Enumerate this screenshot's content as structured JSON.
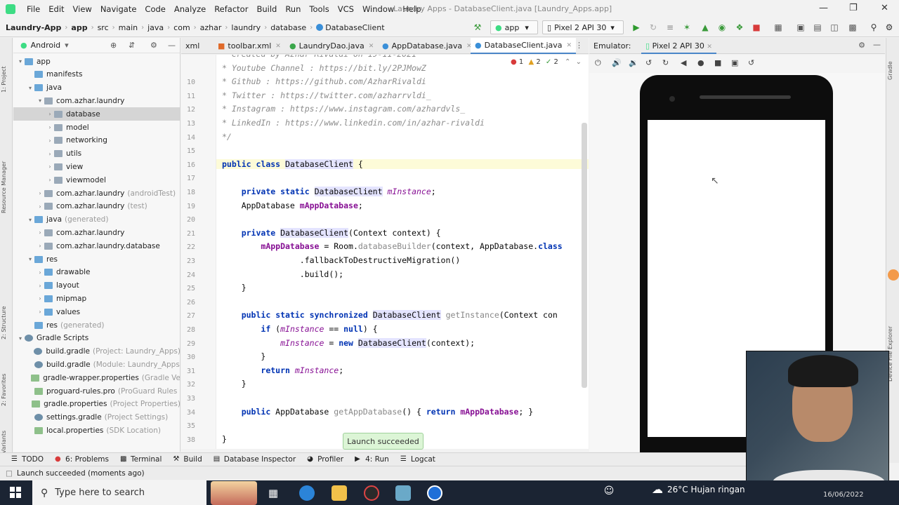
{
  "menu": {
    "items": [
      "File",
      "Edit",
      "View",
      "Navigate",
      "Code",
      "Analyze",
      "Refactor",
      "Build",
      "Run",
      "Tools",
      "VCS",
      "Window",
      "Help"
    ],
    "window_title": "Laundry Apps - DatabaseClient.java [Laundry_Apps.app]"
  },
  "breadcrumb": [
    "Laundry-App",
    "app",
    "src",
    "main",
    "java",
    "com",
    "azhar",
    "laundry",
    "database",
    "DatabaseClient"
  ],
  "toolbar": {
    "run_config": "app",
    "device": "Pixel 2 API 30"
  },
  "project_panel": {
    "view": "Android",
    "tree": [
      {
        "label": "app",
        "note": "",
        "icon": "folder-icon"
      },
      {
        "label": "manifests",
        "note": "",
        "icon": "folder-icon"
      },
      {
        "label": "java",
        "note": "",
        "icon": "folder-icon"
      },
      {
        "label": "com.azhar.laundry",
        "note": "",
        "icon": "package-icon"
      },
      {
        "label": "database",
        "note": "",
        "icon": "package-icon"
      },
      {
        "label": "model",
        "note": "",
        "icon": "package-icon"
      },
      {
        "label": "networking",
        "note": "",
        "icon": "package-icon"
      },
      {
        "label": "utils",
        "note": "",
        "icon": "package-icon"
      },
      {
        "label": "view",
        "note": "",
        "icon": "package-icon"
      },
      {
        "label": "viewmodel",
        "note": "",
        "icon": "package-icon"
      },
      {
        "label": "com.azhar.laundry",
        "note": "(androidTest)",
        "icon": "package-icon"
      },
      {
        "label": "com.azhar.laundry",
        "note": "(test)",
        "icon": "package-icon"
      },
      {
        "label": "java",
        "note": "(generated)",
        "icon": "folder-icon"
      },
      {
        "label": "com.azhar.laundry",
        "note": "",
        "icon": "package-icon"
      },
      {
        "label": "com.azhar.laundry.database",
        "note": "",
        "icon": "package-icon"
      },
      {
        "label": "res",
        "note": "",
        "icon": "folder-icon"
      },
      {
        "label": "drawable",
        "note": "",
        "icon": "folder-icon"
      },
      {
        "label": "layout",
        "note": "",
        "icon": "folder-icon"
      },
      {
        "label": "mipmap",
        "note": "",
        "icon": "folder-icon"
      },
      {
        "label": "values",
        "note": "",
        "icon": "folder-icon"
      },
      {
        "label": "res",
        "note": "(generated)",
        "icon": "folder-icon"
      },
      {
        "label": "Gradle Scripts",
        "note": "",
        "icon": "gradle-icon"
      },
      {
        "label": "build.gradle",
        "note": "(Project: Laundry_Apps)",
        "icon": "gradle-icon"
      },
      {
        "label": "build.gradle",
        "note": "(Module: Laundry_Apps",
        "icon": "gradle-icon"
      },
      {
        "label": "gradle-wrapper.properties",
        "note": "(Gradle Ve",
        "icon": "file-icon"
      },
      {
        "label": "proguard-rules.pro",
        "note": "(ProGuard Rules",
        "icon": "file-icon"
      },
      {
        "label": "gradle.properties",
        "note": "(Project Properties)",
        "icon": "file-icon"
      },
      {
        "label": "settings.gradle",
        "note": "(Project Settings)",
        "icon": "gradle-icon"
      },
      {
        "label": "local.properties",
        "note": "(SDK Location)",
        "icon": "file-icon"
      }
    ]
  },
  "editor": {
    "tabs": [
      "xml",
      "toolbar.xml",
      "LaundryDao.java",
      "AppDatabase.java",
      "DatabaseClient.java"
    ],
    "inspections": {
      "errors": "1",
      "warnings": "2",
      "weak": "2"
    },
    "lines": [
      {
        "n": "",
        "t": "* Created by Azhar Rivaldi on 19-11-2021"
      },
      {
        "n": "",
        "t": "* Youtube Channel : https://bit.ly/2PJMowZ"
      },
      {
        "n": "10",
        "t": "* Github : https://github.com/AzharRivaldi"
      },
      {
        "n": "11",
        "t": "* Twitter : https://twitter.com/azharrvldi_"
      },
      {
        "n": "12",
        "t": "* Instagram : https://www.instagram.com/azhardvls_"
      },
      {
        "n": "13",
        "t": "* LinkedIn : https://www.linkedin.com/in/azhar-rivaldi"
      },
      {
        "n": "14",
        "t": "*/"
      },
      {
        "n": "15",
        "t": ""
      },
      {
        "n": "16",
        "t": "public class DatabaseClient {"
      },
      {
        "n": "17",
        "t": ""
      },
      {
        "n": "18",
        "t": "    private static DatabaseClient mInstance;"
      },
      {
        "n": "19",
        "t": "    AppDatabase mAppDatabase;"
      },
      {
        "n": "20",
        "t": ""
      },
      {
        "n": "21",
        "t": "    private DatabaseClient(Context context) {"
      },
      {
        "n": "22",
        "t": "        mAppDatabase = Room.databaseBuilder(context, AppDatabase.class"
      },
      {
        "n": "23",
        "t": "                .fallbackToDestructiveMigration()"
      },
      {
        "n": "24",
        "t": "                .build();"
      },
      {
        "n": "25",
        "t": "    }"
      },
      {
        "n": "26",
        "t": ""
      },
      {
        "n": "27",
        "t": "    public static synchronized DatabaseClient getInstance(Context con"
      },
      {
        "n": "28",
        "t": "        if (mInstance == null) {"
      },
      {
        "n": "29",
        "t": "            mInstance = new DatabaseClient(context);"
      },
      {
        "n": "30",
        "t": "        }"
      },
      {
        "n": "31",
        "t": "        return mInstance;"
      },
      {
        "n": "32",
        "t": "    }"
      },
      {
        "n": "33",
        "t": ""
      },
      {
        "n": "34",
        "t": "    public AppDatabase getAppDatabase() { return mAppDatabase; }"
      },
      {
        "n": "35",
        "t": ""
      },
      {
        "n": "38",
        "t": "}"
      }
    ]
  },
  "emulator": {
    "label": "Emulator:",
    "device_tab": "Pixel 2 API 30"
  },
  "toast": "Launch succeeded",
  "tool_windows": [
    "TODO",
    "6: Problems",
    "Terminal",
    "Build",
    "Database Inspector",
    "Profiler",
    "4: Run",
    "Logcat"
  ],
  "status": "Launch succeeded (moments ago)",
  "taskbar": {
    "search_placeholder": "Type here to search",
    "weather": "26°C  Hujan ringan",
    "date": "16/06/2022"
  },
  "colors": {
    "accent": "#4a86c8",
    "run_green": "#3ddc84",
    "taskbar": "#1b2433",
    "toast_bg": "#dcf5d6"
  }
}
